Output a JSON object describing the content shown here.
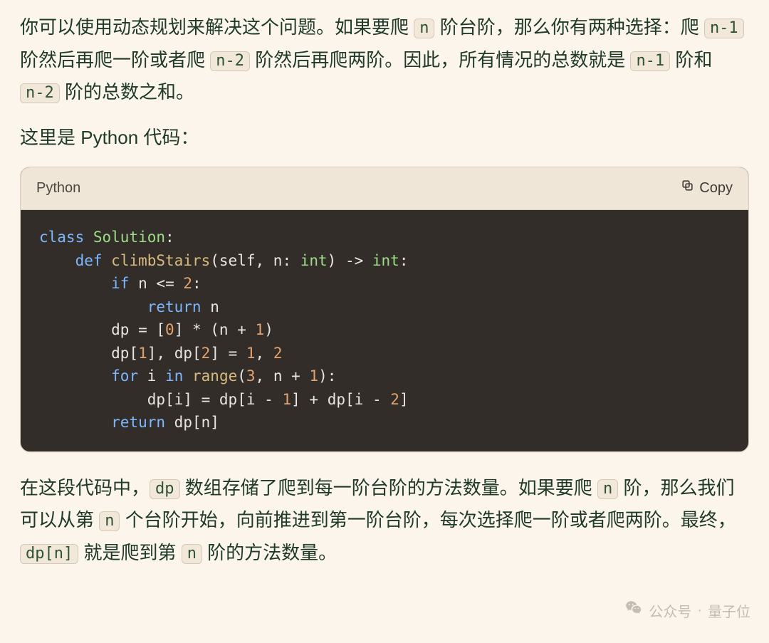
{
  "paragraphs": {
    "p1_a": "你可以使用动态规划来解决这个问题。如果要爬 ",
    "p1_code1": "n",
    "p1_b": " 阶台阶，那么你有两种选择：爬 ",
    "p1_code2": "n-1",
    "p1_c": " 阶然后再爬一阶或者爬 ",
    "p1_code3": "n-2",
    "p1_d": " 阶然后再爬两阶。因此，所有情况的总数就是 ",
    "p1_code4": "n-1",
    "p1_e": " 阶和 ",
    "p1_code5": "n-2",
    "p1_f": " 阶的总数之和。",
    "p2": "这里是 Python 代码：",
    "p3_a": "在这段代码中，",
    "p3_code1": "dp",
    "p3_b": " 数组存储了爬到每一阶台阶的方法数量。如果要爬 ",
    "p3_code2": "n",
    "p3_c": " 阶，那么我们可以从第 ",
    "p3_code3": "n",
    "p3_d": " 个台阶开始，向前推进到第一阶台阶，每次选择爬一阶或者爬两阶。最终，",
    "p3_code4": "dp[n]",
    "p3_e": " 就是爬到第 ",
    "p3_code5": "n",
    "p3_f": " 阶的方法数量。"
  },
  "codeblock": {
    "language": "Python",
    "copy_label": "Copy",
    "tokens": {
      "class": "class",
      "def": "def",
      "if": "if",
      "return": "return",
      "for": "for",
      "in": "in",
      "cls": "Solution",
      "fn": "climbStairs",
      "range": "range",
      "self": "self",
      "n": "n",
      "dp": "dp",
      "i": "i",
      "int": "int",
      "n0": "0",
      "n1": "1",
      "n2": "2",
      "n3": "3"
    }
  },
  "watermark": {
    "label": "公众号",
    "sep": "·",
    "name": "量子位"
  }
}
